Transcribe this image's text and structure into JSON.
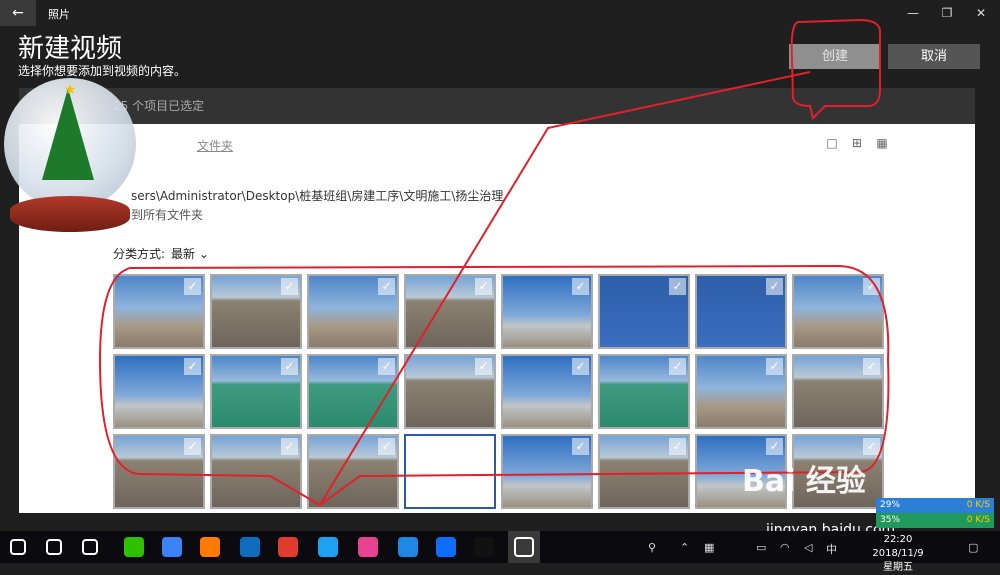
{
  "titlebar": {
    "app_name": "照片",
    "back_icon": "←",
    "minimize": "—",
    "restore": "❐",
    "close": "✕"
  },
  "header": {
    "title": "新建视频",
    "subtitle": "选择你想要添加到视频的内容。",
    "create_label": "创建",
    "cancel_label": "取消"
  },
  "selection": {
    "count_text": "25 个项目已选定"
  },
  "panel": {
    "folder_tab": "文件夹",
    "path": "sers\\Administrator\\Desktop\\桩基班组\\房建工序\\文明施工\\扬尘治理",
    "back_to_all": "到所有文件夹",
    "sort_label": "分类方式:",
    "sort_value": "最新",
    "view_icons": [
      "□",
      "⊞",
      "▦"
    ]
  },
  "thumbnails": [
    {
      "style": "sky",
      "checked": "✓"
    },
    {
      "style": "road",
      "checked": "✓"
    },
    {
      "style": "sky",
      "checked": "✓"
    },
    {
      "style": "road",
      "checked": "✓"
    },
    {
      "style": "sky2",
      "checked": "✓"
    },
    {
      "style": "blue",
      "checked": "✓"
    },
    {
      "style": "blue",
      "checked": "✓"
    },
    {
      "style": "sky",
      "checked": "✓"
    },
    {
      "style": "sky2",
      "checked": "✓"
    },
    {
      "style": "net",
      "checked": "✓"
    },
    {
      "style": "net",
      "checked": "✓"
    },
    {
      "style": "road",
      "checked": "✓"
    },
    {
      "style": "sky2",
      "checked": "✓"
    },
    {
      "style": "net",
      "checked": "✓"
    },
    {
      "style": "sky",
      "checked": "✓"
    },
    {
      "style": "road",
      "checked": "✓"
    },
    {
      "style": "road",
      "checked": "✓"
    },
    {
      "style": "road",
      "checked": "✓"
    },
    {
      "style": "road",
      "checked": "✓"
    },
    {
      "style": "poster",
      "checked": "✓"
    },
    {
      "style": "sky2",
      "checked": "✓"
    },
    {
      "style": "road",
      "checked": "✓"
    },
    {
      "style": "sky2",
      "checked": "✓"
    },
    {
      "style": "road",
      "checked": "✓"
    }
  ],
  "taskbar": {
    "clock_time": "22:20",
    "clock_date": "2018/11/9 星期五",
    "ime": "中",
    "icons": [
      "windows-start-icon",
      "search-icon",
      "task-view-icon",
      "wechat-icon",
      "feishu-icon",
      "ring-icon",
      "outlook-icon",
      "it-icon",
      "browser-icon",
      "colorwheel-icon",
      "headset-icon",
      "translate-icon",
      "qq-icon",
      "photos-icon"
    ]
  },
  "netspeed": {
    "up": "0 K/S",
    "down": "0 K/S",
    "cpu": "29%",
    "mem": "35%"
  },
  "watermark": {
    "brand": "Bai 经验",
    "url": "jingyan.baidu.com"
  },
  "colors": {
    "accent_red": "#e0202a",
    "panel_bg": "#ffffff",
    "window_bg": "#1f1f1f"
  }
}
